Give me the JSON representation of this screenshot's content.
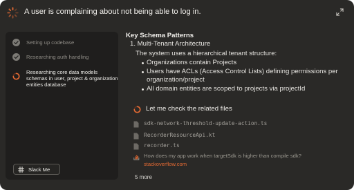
{
  "header": {
    "title": "A user is complaining about not being able to log in.",
    "status_icon": "loading-spinner-icon",
    "expand_icon": "expand-icon"
  },
  "sidebar": {
    "steps": [
      {
        "label": "Setting up codebase",
        "state": "done",
        "icon": "check-circle-icon"
      },
      {
        "label": "Researching auth handling",
        "state": "done",
        "icon": "check-circle-icon"
      },
      {
        "label": "Researching core data models schemas in user, project & organization entities database",
        "state": "in-progress",
        "icon": "loading-ring-icon"
      }
    ],
    "slack_button": {
      "label": "Slack Me",
      "icon": "slack-icon"
    }
  },
  "main": {
    "heading": "Key Schema Patterns",
    "list_item_1": "1. Multi-Tenant Architecture",
    "paragraph": "The system uses a hierarchical tenant structure:",
    "bullets": [
      "Organizations contain Projects",
      "Users have ACLs (Access Control Lists) defining permissions per",
      "organization/project",
      "All domain entities are scoped to projects via projectId"
    ],
    "check_files_label": "Let me check the related files",
    "files": [
      {
        "name": "sdk-network-threshold-update-action.ts",
        "icon": "file-icon"
      },
      {
        "name": "RecorderResourceApi.kt",
        "icon": "file-icon"
      },
      {
        "name": "recorder.ts",
        "icon": "file-icon"
      }
    ],
    "stackoverflow": {
      "question": "How does my app work when targetSdk is higher than compile sdk?",
      "source": "stackoverflow.com",
      "icon": "stackoverflow-icon"
    },
    "more_label": "5 more"
  },
  "colors": {
    "window_bg": "#2a2927",
    "sidebar_bg": "#1f1e1d",
    "accent_orange": "#e46a33"
  }
}
